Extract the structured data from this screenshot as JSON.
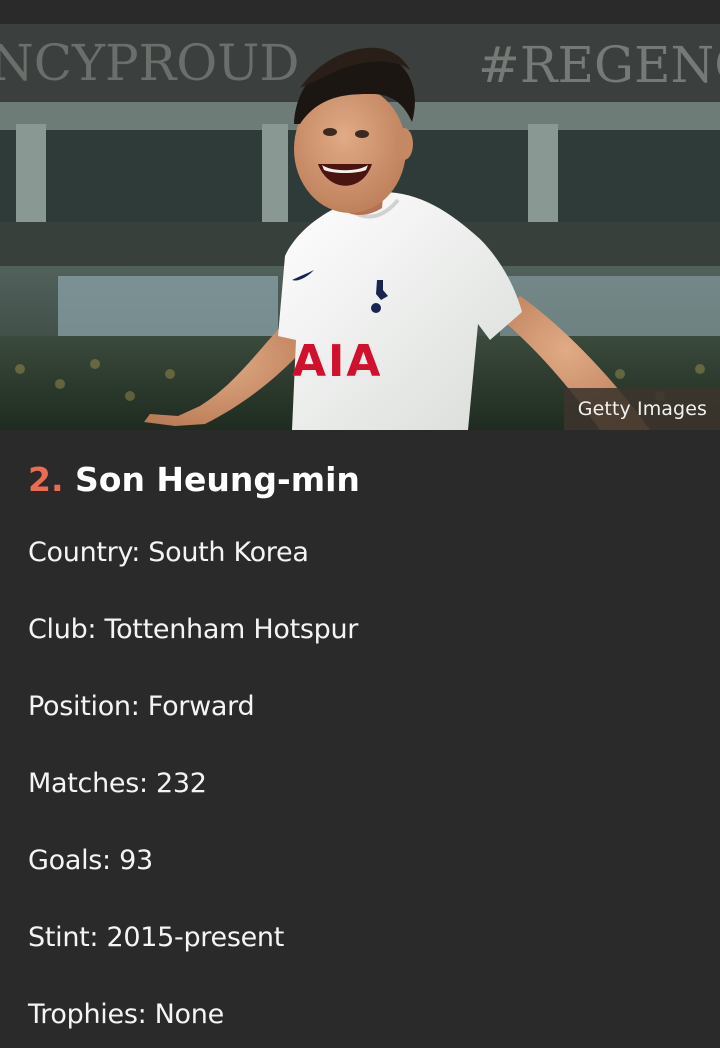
{
  "photo": {
    "alt": "Son Heung-min",
    "credit": "Getty Images",
    "background_banner_left": "NCYPROUD",
    "background_banner_right": "#REGENCY",
    "shirt_sponsor": "AIA"
  },
  "player": {
    "rank": "2.",
    "name": "Son Heung-min",
    "facts": [
      "Country: South Korea",
      "Club: Tottenham Hotspur",
      "Position: Forward",
      "Matches: 232",
      "Goals: 93",
      "Stint: 2015-present",
      "Trophies: None"
    ]
  },
  "colors": {
    "background": "#2a2a2a",
    "rank_accent": "#ef6b4f",
    "text": "#ffffff",
    "sponsor_red": "#d0102c"
  }
}
